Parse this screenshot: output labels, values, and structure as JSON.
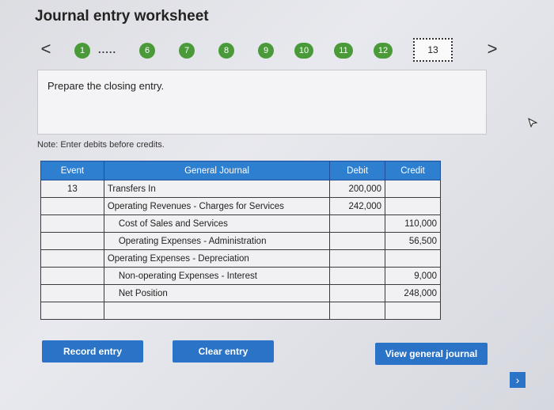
{
  "title": "Journal entry worksheet",
  "nav": {
    "prev_arrow": "<",
    "next_arrow": ">",
    "dots": ".....",
    "steps": [
      "1",
      "6",
      "7",
      "8",
      "9",
      "10",
      "11",
      "12"
    ],
    "current_step": "13"
  },
  "prompt": "Prepare the closing entry.",
  "note": "Note: Enter debits before credits.",
  "table": {
    "headers": {
      "event": "Event",
      "account": "General Journal",
      "debit": "Debit",
      "credit": "Credit"
    },
    "rows": [
      {
        "event": "13",
        "account": "Transfers In",
        "debit": "200,000",
        "credit": ""
      },
      {
        "event": "",
        "account": "Operating Revenues - Charges for Services",
        "debit": "242,000",
        "credit": ""
      },
      {
        "event": "",
        "account": "Cost of Sales and Services",
        "debit": "",
        "credit": "110,000"
      },
      {
        "event": "",
        "account": "Operating Expenses - Administration",
        "debit": "",
        "credit": "56,500"
      },
      {
        "event": "",
        "account": "Operating Expenses - Depreciation",
        "debit": "",
        "credit": ""
      },
      {
        "event": "",
        "account": "Non-operating Expenses - Interest",
        "debit": "",
        "credit": "9,000"
      },
      {
        "event": "",
        "account": "Net Position",
        "debit": "",
        "credit": "248,000"
      },
      {
        "event": "",
        "account": "",
        "debit": "",
        "credit": ""
      }
    ]
  },
  "buttons": {
    "record": "Record entry",
    "clear": "Clear entry",
    "view": "View general journal"
  },
  "colors": {
    "step_green": "#4a9a3a",
    "header_blue": "#2f7fd1",
    "button_blue": "#2a73c6"
  }
}
